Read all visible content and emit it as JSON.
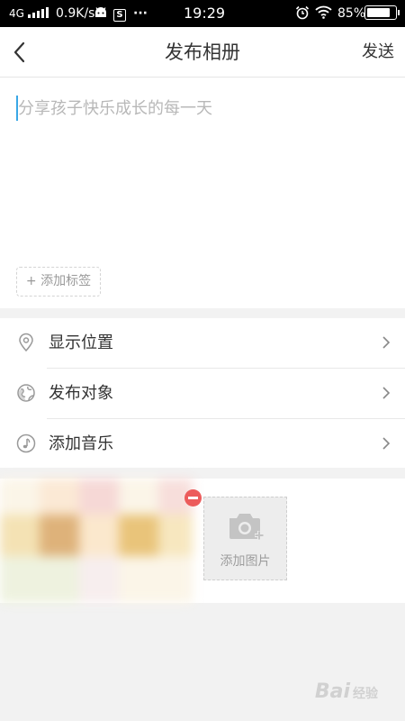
{
  "status_bar": {
    "network_type": "4G",
    "speed": "0.9K/s",
    "sync_badge": "S",
    "more": "···",
    "time": "19:29",
    "battery_percent": "85%",
    "battery_level": 0.85
  },
  "header": {
    "back_icon": "chevron-left-icon",
    "title": "发布相册",
    "send_label": "发送"
  },
  "composer": {
    "placeholder": "分享孩子快乐成长的每一天",
    "value": "",
    "add_tag_label": "+ 添加标签"
  },
  "options": [
    {
      "icon": "location-pin-icon",
      "label": "显示位置"
    },
    {
      "icon": "globe-icon",
      "label": "发布对象"
    },
    {
      "icon": "music-note-icon",
      "label": "添加音乐"
    }
  ],
  "photos": {
    "count": 1,
    "remove_icon": "remove-minus-icon",
    "add_photo_label": "添加图片",
    "add_photo_icon": "camera-plus-icon"
  },
  "colors": {
    "accent_caret": "#3aa7e6",
    "remove_red": "#ec5b5b",
    "background": "#f2f2f2"
  },
  "watermark": {
    "text": "Bai",
    "suffix": "经验"
  }
}
